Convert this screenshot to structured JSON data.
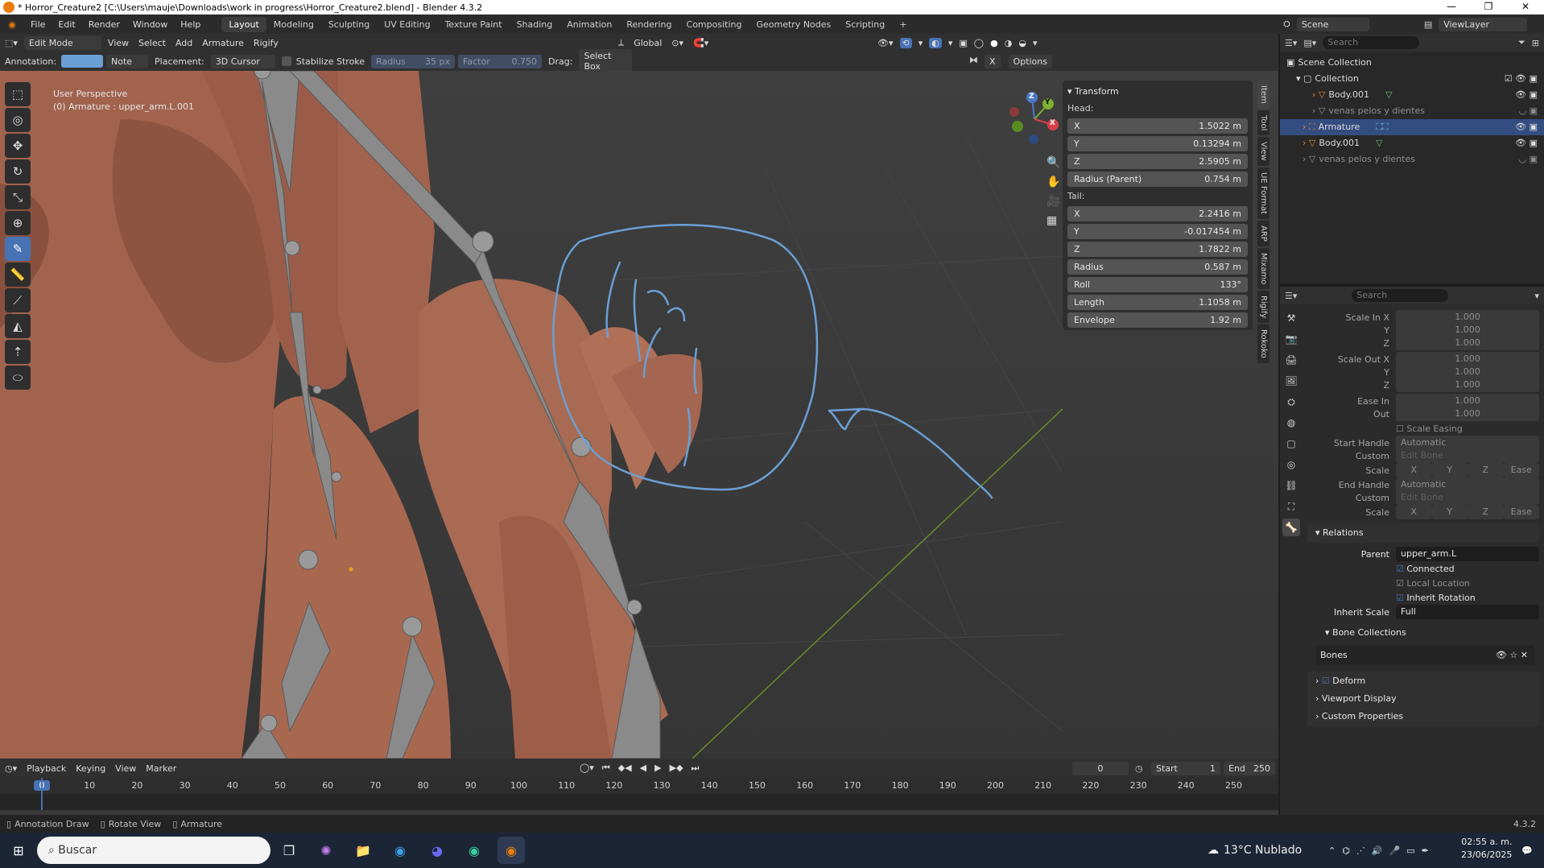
{
  "window": {
    "title": "* Horror_Creature2 [C:\\Users\\mauje\\Downloads\\work in progress\\Horror_Creature2.blend] - Blender 4.3.2",
    "minimize": "—",
    "maximize": "❐",
    "close": "✕"
  },
  "menus": [
    "File",
    "Edit",
    "Render",
    "Window",
    "Help"
  ],
  "workspaces": [
    "Layout",
    "Modeling",
    "Sculpting",
    "UV Editing",
    "Texture Paint",
    "Shading",
    "Animation",
    "Rendering",
    "Compositing",
    "Geometry Nodes",
    "Scripting"
  ],
  "add_workspace": "+",
  "scene": {
    "name": "Scene",
    "view_layer": "ViewLayer"
  },
  "viewport_header": {
    "mode": "Edit Mode",
    "items": [
      "View",
      "Select",
      "Add",
      "Armature",
      "Rigify"
    ],
    "orientation": "Global"
  },
  "tool_header": {
    "annotation_label": "Annotation:",
    "annotation_color": "#6a9fd4",
    "note": "Note",
    "placement_label": "Placement:",
    "placement": "3D Cursor",
    "stabilize": "Stabilize Stroke",
    "radius_label": "Radius",
    "radius_value": "35 px",
    "factor_label": "Factor",
    "factor_value": "0.750",
    "drag_label": "Drag:",
    "drag_value": "Select Box",
    "x_label": "X",
    "options": "Options"
  },
  "viewport": {
    "perspective": "User Perspective",
    "object_info": "(0) Armature : upper_arm.L.001",
    "gizmo": {
      "z": "Z",
      "y": "Y",
      "x": "X"
    }
  },
  "tools": [
    {
      "icon": "select-box-icon",
      "glyph": "⬚"
    },
    {
      "icon": "cursor-icon",
      "glyph": "◎"
    },
    {
      "icon": "move-icon",
      "glyph": "✥"
    },
    {
      "icon": "rotate-icon",
      "glyph": "↻"
    },
    {
      "icon": "scale-icon",
      "glyph": "⤡"
    },
    {
      "icon": "transform-icon",
      "glyph": "⊕"
    },
    {
      "icon": "annotate-icon",
      "glyph": "✎",
      "active": true
    },
    {
      "icon": "measure-icon",
      "glyph": "📏"
    },
    {
      "icon": "bone-roll-icon",
      "glyph": "⟋"
    },
    {
      "icon": "bone-size-icon",
      "glyph": "◭"
    },
    {
      "icon": "extrude-icon",
      "glyph": "⇡"
    },
    {
      "icon": "envelope-icon",
      "glyph": "⬭"
    }
  ],
  "transform": {
    "title": "Transform",
    "head_label": "Head:",
    "head": [
      {
        "k": "X",
        "v": "1.5022 m"
      },
      {
        "k": "Y",
        "v": "0.13294 m"
      },
      {
        "k": "Z",
        "v": "2.5905 m"
      }
    ],
    "radius_parent": {
      "k": "Radius (Parent)",
      "v": "0.754 m"
    },
    "tail_label": "Tail:",
    "tail": [
      {
        "k": "X",
        "v": "2.2416 m"
      },
      {
        "k": "Y",
        "v": "-0.017454 m"
      },
      {
        "k": "Z",
        "v": "1.7822 m"
      }
    ],
    "extra": [
      {
        "k": "Radius",
        "v": "0.587 m"
      },
      {
        "k": "Roll",
        "v": "133°"
      },
      {
        "k": "Length",
        "v": "1.1058 m"
      },
      {
        "k": "Envelope",
        "v": "1.92 m"
      }
    ]
  },
  "vtabs": [
    "Item",
    "Tool",
    "View",
    "UE Format",
    "ARP",
    "Mixamo",
    "Rigify",
    "Rokoko"
  ],
  "outliner": {
    "search": "Search",
    "rows": [
      {
        "label": "Scene Collection",
        "indent": 0
      },
      {
        "label": "Collection",
        "indent": 1
      },
      {
        "label": "Body.001",
        "indent": 2
      },
      {
        "label": "venas pelos y dientes",
        "indent": 2,
        "dim": true
      },
      {
        "label": "Armature",
        "indent": 1,
        "selected": true
      },
      {
        "label": "Body.001",
        "indent": 1
      },
      {
        "label": "venas pelos y dientes",
        "indent": 1,
        "dim": true
      }
    ]
  },
  "properties": {
    "search": "Search",
    "rows": [
      {
        "label": "Scale In X",
        "value": "1.000"
      },
      {
        "label": "Y",
        "value": "1.000"
      },
      {
        "label": "Z",
        "value": "1.000"
      },
      {
        "label": "Scale Out X",
        "value": "1.000"
      },
      {
        "label": "Y",
        "value": "1.000"
      },
      {
        "label": "Z",
        "value": "1.000"
      },
      {
        "label": "Ease In",
        "value": "1.000"
      },
      {
        "label": "Out",
        "value": "1.000"
      }
    ],
    "scale_easing": "Scale Easing",
    "start_handle": {
      "label": "Start Handle",
      "value": "Automatic"
    },
    "end_handle": {
      "label": "End Handle",
      "value": "Automatic"
    },
    "custom_label": "Custom",
    "edit_bone": "Edit Bone",
    "scale_label": "Scale",
    "xyz": [
      "X",
      "Y",
      "Z",
      "Ease"
    ],
    "relations": "Relations",
    "parent_label": "Parent",
    "parent_value": "upper_arm.L",
    "connected": "Connected",
    "local_location": "Local Location",
    "inherit_rotation": "Inherit Rotation",
    "inherit_scale_label": "Inherit Scale",
    "inherit_scale_value": "Full",
    "bone_collections": "Bone Collections",
    "bones": "Bones",
    "deform": "Deform",
    "viewport_display": "Viewport Display",
    "custom_properties": "Custom Properties"
  },
  "timeline": {
    "items": [
      "Playback",
      "Keying",
      "View",
      "Marker"
    ],
    "current_frame": "0",
    "start_label": "Start",
    "start": "1",
    "end_label": "End",
    "end": "250",
    "ticks": [
      "0",
      "10",
      "20",
      "30",
      "40",
      "50",
      "60",
      "70",
      "80",
      "90",
      "100",
      "110",
      "120",
      "130",
      "140",
      "150",
      "160",
      "170",
      "180",
      "190",
      "200",
      "210",
      "220",
      "230",
      "240",
      "250"
    ]
  },
  "status": {
    "items": [
      "Annotation Draw",
      "Rotate View",
      "Armature"
    ],
    "version": "4.3.2"
  },
  "taskbar": {
    "search": "Buscar",
    "weather": "13°C  Nublado",
    "time": "02:55 a. m.",
    "date": "23/06/2025"
  }
}
